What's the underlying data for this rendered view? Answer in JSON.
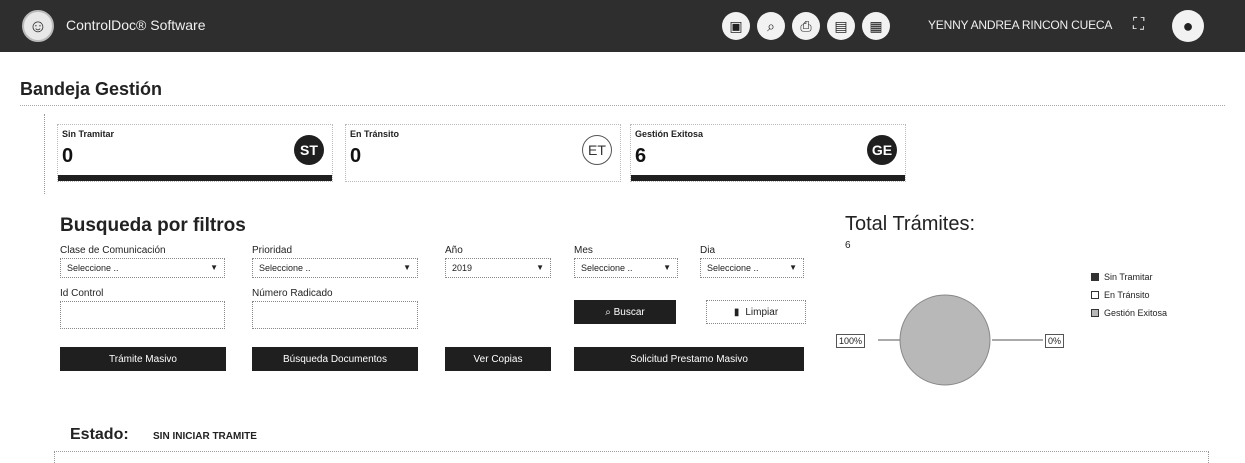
{
  "topbar": {
    "app_title": "ControlDoc® Software",
    "user_name": "YENNY ANDREA RINCON CUECA",
    "icons": [
      "document-icon",
      "search-icon",
      "print-icon",
      "inbox-icon",
      "report-icon"
    ]
  },
  "page": {
    "title": "Bandeja Gestión"
  },
  "cards": [
    {
      "label": "Sin Tramitar",
      "value": "0",
      "badge": "ST"
    },
    {
      "label": "En Tránsito",
      "value": "0",
      "badge": "ET"
    },
    {
      "label": "Gestión Exitosa",
      "value": "6",
      "badge": "GE"
    }
  ],
  "filters": {
    "title": "Busqueda por filtros",
    "clase_label": "Clase de Comunicación",
    "clase_value": "Seleccione ..",
    "prioridad_label": "Prioridad",
    "prioridad_value": "Seleccione ..",
    "anio_label": "Año",
    "anio_value": "2019",
    "mes_label": "Mes",
    "mes_value": "Seleccione ..",
    "dia_label": "Dia",
    "dia_value": "Seleccione ..",
    "id_control_label": "Id Control",
    "numero_radicado_label": "Número Radicado",
    "buscar_label": "Buscar",
    "limpiar_label": "Limpiar"
  },
  "actions": {
    "tramite_masivo": "Trámite Masivo",
    "busqueda_documentos": "Búsqueda Documentos",
    "ver_copias": "Ver Copias",
    "solicitud_prestamo": "Solicitud Prestamo Masivo"
  },
  "chart_data": {
    "type": "pie",
    "title": "Total Trámites:",
    "total": "6",
    "categories": [
      "Sin Tramitar",
      "En Tránsito",
      "Gestión Exitosa"
    ],
    "values": [
      0,
      0,
      6
    ],
    "labels": [
      "100%",
      "0%"
    ],
    "legend_position": "right"
  },
  "estado": {
    "label": "Estado:",
    "value": "SIN INICIAR TRAMITE"
  }
}
